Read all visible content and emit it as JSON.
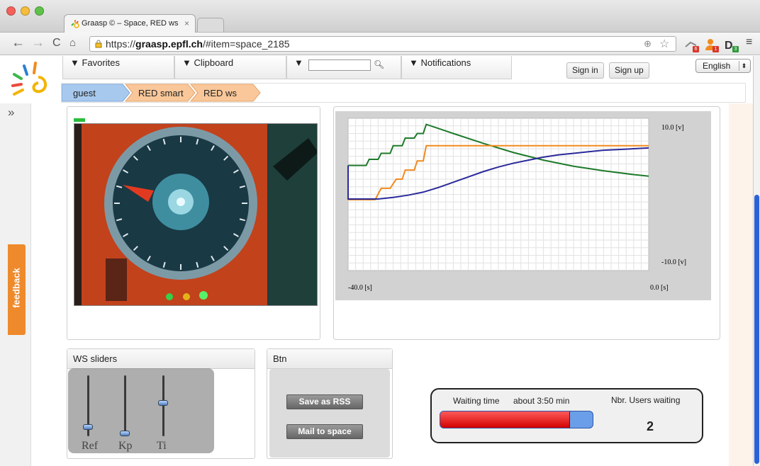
{
  "browser": {
    "tab_title": "Graasp © – Space, RED ws",
    "tab_close": "×",
    "url_scheme": "https://",
    "url_host": "graasp.epfl.ch",
    "url_path": "/#item=space_2185",
    "extensions": [
      {
        "name": "graasp-extension-icon",
        "badge": "6",
        "color": "#d9362b"
      },
      {
        "name": "user-extension-icon",
        "badge": "1",
        "color": "#d9362b"
      },
      {
        "name": "d-extension-icon",
        "badge": "3",
        "color": "#2e9a3a"
      }
    ]
  },
  "nav": {
    "favorites": "▼ Favorites",
    "clipboard": "▼ Clipboard",
    "search_prefix": "▼",
    "notifications": "▼ Notifications",
    "sign_in": "Sign in",
    "sign_up": "Sign up",
    "language": "English"
  },
  "breadcrumb": [
    "guest",
    "RED smart",
    "RED ws"
  ],
  "feedback": "feedback",
  "chart_data": {
    "type": "line",
    "x_range": [
      -40,
      0
    ],
    "y_range": [
      -10,
      10
    ],
    "x_labels": [
      "-40.0 [s]",
      "0.0 [s]"
    ],
    "y_labels": [
      "10.0 [v]",
      "-10.0 [v]"
    ],
    "grid": true,
    "series": [
      {
        "color": "#1e7a2a",
        "points": [
          [
            -40,
            3.8
          ],
          [
            -37.6,
            3.8
          ],
          [
            -37.2,
            4.6
          ],
          [
            -36,
            4.6
          ],
          [
            -35.6,
            5.4
          ],
          [
            -34.4,
            5.4
          ],
          [
            -34,
            6.4
          ],
          [
            -32.8,
            6.4
          ],
          [
            -32.4,
            7.4
          ],
          [
            -31.2,
            7.4
          ],
          [
            -30.8,
            8.0
          ],
          [
            -30,
            8.0
          ],
          [
            -29.6,
            9.2
          ],
          [
            -26,
            8.0
          ],
          [
            -22,
            6.7
          ],
          [
            -18,
            5.5
          ],
          [
            -14,
            4.5
          ],
          [
            -10,
            3.7
          ],
          [
            -6,
            3.1
          ],
          [
            -2,
            2.6
          ],
          [
            0,
            2.4
          ]
        ]
      },
      {
        "color": "#f28a1e",
        "points": [
          [
            -40,
            -0.7
          ],
          [
            -36.4,
            -0.7
          ],
          [
            -35.6,
            0.8
          ],
          [
            -34.4,
            0.8
          ],
          [
            -33.6,
            2.0
          ],
          [
            -32.8,
            2.0
          ],
          [
            -32.4,
            3.2
          ],
          [
            -31.2,
            3.2
          ],
          [
            -30.8,
            4.4
          ],
          [
            -30,
            4.4
          ],
          [
            -29.6,
            6.4
          ],
          [
            -28,
            6.4
          ],
          [
            -24,
            6.4
          ],
          [
            -16,
            6.4
          ],
          [
            -8,
            6.4
          ],
          [
            0,
            6.4
          ]
        ]
      },
      {
        "color": "#2a2a9a",
        "points": [
          [
            -40,
            3.8
          ],
          [
            -40,
            -0.6
          ],
          [
            -36,
            -0.6
          ],
          [
            -34,
            -0.4
          ],
          [
            -32,
            -0.1
          ],
          [
            -30,
            0.3
          ],
          [
            -28,
            0.9
          ],
          [
            -26,
            1.6
          ],
          [
            -24,
            2.3
          ],
          [
            -22,
            3.0
          ],
          [
            -20,
            3.6
          ],
          [
            -18,
            4.1
          ],
          [
            -16,
            4.5
          ],
          [
            -14,
            4.9
          ],
          [
            -12,
            5.2
          ],
          [
            -10,
            5.4
          ],
          [
            -8,
            5.6
          ],
          [
            -6,
            5.8
          ],
          [
            -4,
            5.9
          ],
          [
            -2,
            6.0
          ],
          [
            0,
            6.1
          ]
        ]
      }
    ]
  },
  "panels": {
    "sliders_title": "WS sliders",
    "btn_title": "Btn"
  },
  "sliders": [
    {
      "label": "Ref",
      "level": 0.15
    },
    {
      "label": "Kp",
      "level": 0.05
    },
    {
      "label": "Ti",
      "level": 0.55
    }
  ],
  "buttons": {
    "save_rss": "Save as RSS",
    "mail_space": "Mail to space"
  },
  "queue": {
    "waiting_label": "Waiting time",
    "waiting_value": "about  3:50 min",
    "users_label": "Nbr. Users waiting",
    "users_count": "2",
    "progress": 0.85
  }
}
